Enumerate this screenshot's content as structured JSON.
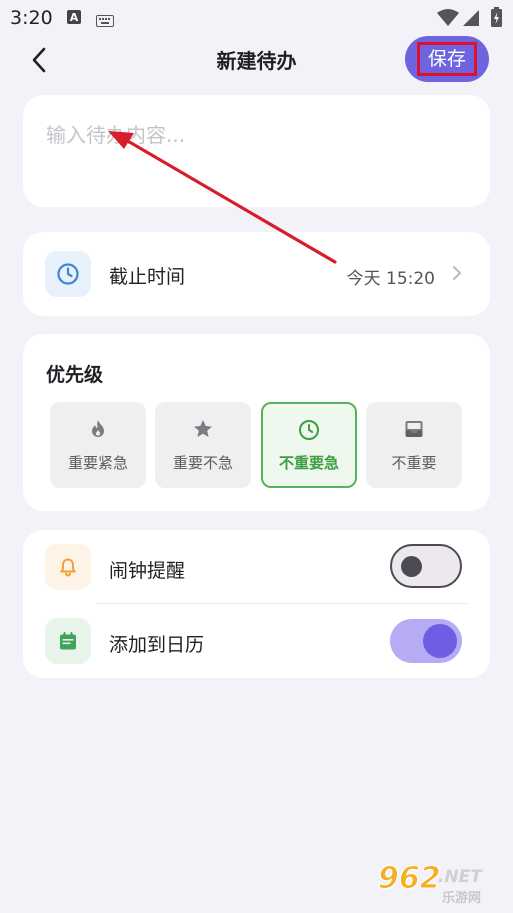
{
  "status_bar": {
    "time": "3:20"
  },
  "header": {
    "title": "新建待办",
    "save_label": "保存"
  },
  "content": {
    "placeholder": "输入待办内容..."
  },
  "deadline": {
    "label": "截止时间",
    "value": "今天 15:20"
  },
  "priority": {
    "title": "优先级",
    "options": [
      {
        "label": "重要紧急",
        "icon": "flame-icon",
        "selected": false
      },
      {
        "label": "重要不急",
        "icon": "star-icon",
        "selected": false
      },
      {
        "label": "不重要急",
        "icon": "clock-icon",
        "selected": true
      },
      {
        "label": "不重要",
        "icon": "inbox-icon",
        "selected": false
      }
    ]
  },
  "reminders": {
    "alarm": {
      "label": "闹钟提醒",
      "enabled": false
    },
    "calendar": {
      "label": "添加到日历",
      "enabled": true
    }
  },
  "watermark": {
    "text": "962.NET",
    "subtext": "乐游网"
  },
  "colors": {
    "accent": "#6f64df",
    "selected_priority": "#58b35a",
    "annotation_red": "#e0102a",
    "background": "#f3f2f8"
  }
}
